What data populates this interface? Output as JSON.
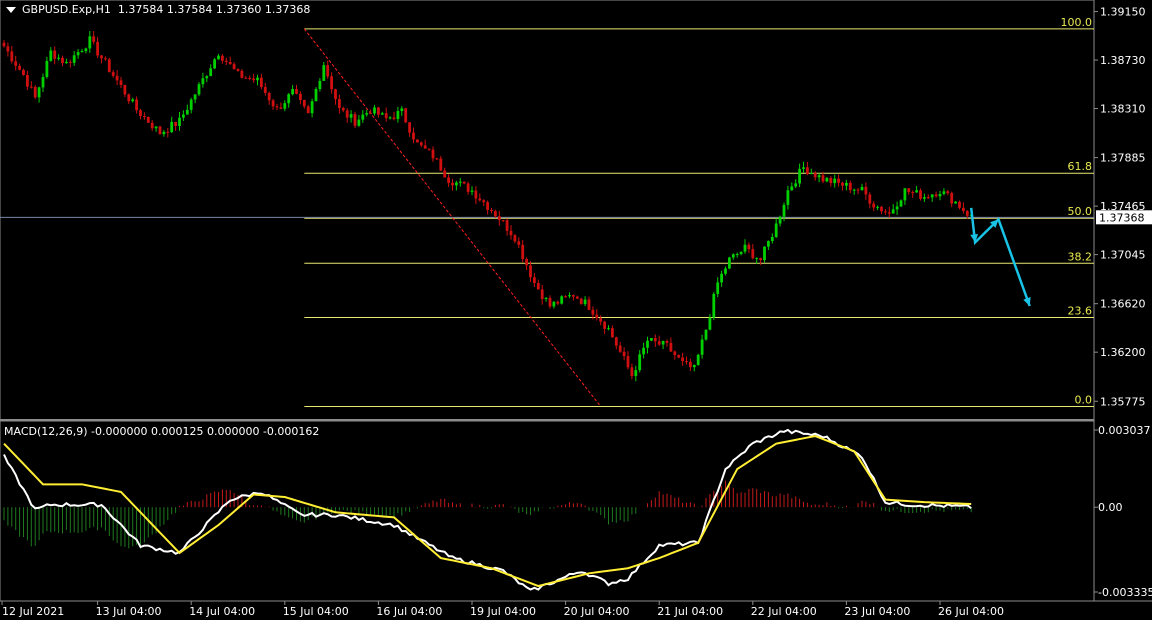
{
  "window": {
    "symbol_label": "GBPUSD.Exp,H1",
    "ohlc_label": "1.37584 1.37584 1.37360 1.37368"
  },
  "macd": {
    "title": "MACD(12,26,9) -0.000000 0.000125 0.000000 -0.000162",
    "axis_ticks": [
      "0.003037",
      "0.00",
      "-0.003335"
    ],
    "tick_values": [
      0.003037,
      0.0,
      -0.003335
    ]
  },
  "colors": {
    "background": "#000000",
    "bull_candle": "#00d000",
    "bear_candle": "#d01010",
    "fib_line": "#e8e870",
    "fib_text": "#e8e850",
    "trend_line": "#ff2020",
    "forecast_arrow": "#19c3e6",
    "macd_main": "#ffffff",
    "macd_signal": "#ffee33",
    "price_line": "#7a86a8",
    "axis_text": "#ffffff"
  },
  "chart_data": {
    "type": "candlestick",
    "symbol": "GBPUSD.Exp",
    "timeframe": "H1",
    "current_price": "1.37368",
    "ylim": [
      1.3563,
      1.3925
    ],
    "y_ticks": [
      "1.39150",
      "1.38730",
      "1.38310",
      "1.37885",
      "1.37465",
      "1.37045",
      "1.36620",
      "1.36200",
      "1.35775"
    ],
    "x_ticks": [
      "12 Jul 2021",
      "13 Jul 04:00",
      "14 Jul 04:00",
      "15 Jul 04:00",
      "16 Jul 04:00",
      "19 Jul 04:00",
      "20 Jul 04:00",
      "21 Jul 04:00",
      "22 Jul 04:00",
      "23 Jul 04:00",
      "26 Jul 04:00"
    ],
    "fibonacci": {
      "high": 1.39,
      "low": 1.3573,
      "levels": [
        {
          "label": "100.0",
          "value": 1.39
        },
        {
          "label": "61.8",
          "value": 1.3775
        },
        {
          "label": "50.0",
          "value": 1.3736
        },
        {
          "label": "38.2",
          "value": 1.3697
        },
        {
          "label": "23.6",
          "value": 1.365
        },
        {
          "label": "0.0",
          "value": 1.3573
        }
      ]
    },
    "path_keypoints": [
      [
        0,
        1.3885
      ],
      [
        5,
        1.386
      ],
      [
        8,
        1.384
      ],
      [
        12,
        1.388
      ],
      [
        16,
        1.387
      ],
      [
        22,
        1.389
      ],
      [
        28,
        1.386
      ],
      [
        34,
        1.383
      ],
      [
        40,
        1.381
      ],
      [
        45,
        1.382
      ],
      [
        50,
        1.385
      ],
      [
        55,
        1.388
      ],
      [
        60,
        1.386
      ],
      [
        65,
        1.3855
      ],
      [
        70,
        1.383
      ],
      [
        74,
        1.3845
      ],
      [
        78,
        1.3825
      ],
      [
        82,
        1.387
      ],
      [
        86,
        1.383
      ],
      [
        90,
        1.382
      ],
      [
        94,
        1.383
      ],
      [
        98,
        1.3822
      ],
      [
        102,
        1.3828
      ],
      [
        106,
        1.38
      ],
      [
        110,
        1.379
      ],
      [
        114,
        1.377
      ],
      [
        120,
        1.376
      ],
      [
        126,
        1.374
      ],
      [
        131,
        1.372
      ],
      [
        136,
        1.368
      ],
      [
        140,
        1.366
      ],
      [
        146,
        1.367
      ],
      [
        150,
        1.366
      ],
      [
        155,
        1.364
      ],
      [
        158,
        1.362
      ],
      [
        161,
        1.36
      ],
      [
        165,
        1.363
      ],
      [
        170,
        1.3625
      ],
      [
        174,
        1.361
      ],
      [
        177,
        1.3605
      ],
      [
        180,
        1.364
      ],
      [
        183,
        1.368
      ],
      [
        186,
        1.37
      ],
      [
        190,
        1.371
      ],
      [
        194,
        1.37
      ],
      [
        198,
        1.373
      ],
      [
        201,
        1.376
      ],
      [
        205,
        1.378
      ],
      [
        210,
        1.377
      ],
      [
        215,
        1.3765
      ],
      [
        220,
        1.376
      ],
      [
        223,
        1.3748
      ],
      [
        227,
        1.374
      ],
      [
        231,
        1.376
      ],
      [
        236,
        1.3755
      ],
      [
        240,
        1.376
      ],
      [
        244,
        1.375
      ],
      [
        248,
        1.3737
      ]
    ],
    "forecast_path": [
      [
        248,
        1.3745
      ],
      [
        249,
        1.3715
      ],
      [
        255,
        1.3735
      ],
      [
        263,
        1.366
      ]
    ],
    "trend_line": [
      [
        77,
        1.39
      ],
      [
        153,
        1.3573
      ]
    ],
    "macd_keypoints": [
      [
        0,
        0.002
      ],
      [
        8,
        -0.0001
      ],
      [
        12,
        0.0001
      ],
      [
        25,
        0.0001
      ],
      [
        35,
        -0.0015
      ],
      [
        45,
        -0.0018
      ],
      [
        58,
        0.0003
      ],
      [
        66,
        0.0006
      ],
      [
        76,
        -0.0003
      ],
      [
        85,
        -0.0003
      ],
      [
        100,
        -0.0007
      ],
      [
        115,
        -0.002
      ],
      [
        128,
        -0.0025
      ],
      [
        135,
        -0.0033
      ],
      [
        148,
        -0.0025
      ],
      [
        155,
        -0.003
      ],
      [
        160,
        -0.0028
      ],
      [
        168,
        -0.0015
      ],
      [
        178,
        -0.0014
      ],
      [
        185,
        0.0015
      ],
      [
        192,
        0.0025
      ],
      [
        200,
        0.003
      ],
      [
        210,
        0.0028
      ],
      [
        220,
        0.002
      ],
      [
        226,
        0.0002
      ],
      [
        232,
        0.0001
      ],
      [
        242,
        5e-05
      ],
      [
        248,
        -0.0
      ]
    ],
    "signal_keypoints": [
      [
        0,
        0.0025
      ],
      [
        10,
        0.0009
      ],
      [
        20,
        0.0009
      ],
      [
        30,
        0.0006
      ],
      [
        45,
        -0.0018
      ],
      [
        55,
        -0.0007
      ],
      [
        64,
        0.0005
      ],
      [
        72,
        0.0004
      ],
      [
        85,
        -0.0002
      ],
      [
        100,
        -0.0004
      ],
      [
        112,
        -0.002
      ],
      [
        125,
        -0.0024
      ],
      [
        137,
        -0.0031
      ],
      [
        150,
        -0.0026
      ],
      [
        160,
        -0.0024
      ],
      [
        168,
        -0.002
      ],
      [
        178,
        -0.0014
      ],
      [
        188,
        0.0015
      ],
      [
        198,
        0.0025
      ],
      [
        208,
        0.0028
      ],
      [
        218,
        0.0022
      ],
      [
        226,
        0.0003
      ],
      [
        236,
        0.0002
      ],
      [
        248,
        0.000125
      ]
    ]
  }
}
